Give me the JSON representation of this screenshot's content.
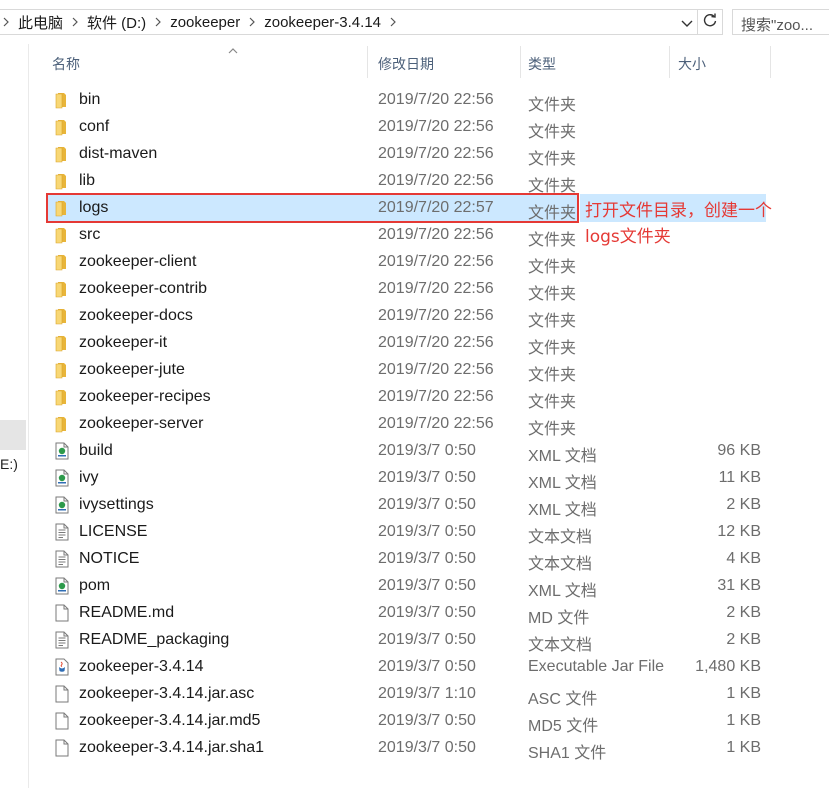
{
  "address_bar": {
    "segments": [
      "此电脑",
      "软件 (D:)",
      "zookeeper",
      "zookeeper-3.4.14"
    ],
    "search_placeholder": "搜索\"zoo..."
  },
  "nav_pane": {
    "partial_label": "E:)"
  },
  "columns": {
    "name": "名称",
    "date": "修改日期",
    "type": "类型",
    "size": "大小"
  },
  "files": [
    {
      "name": "bin",
      "date": "2019/7/20 22:56",
      "type": "文件夹",
      "size": "",
      "icon": "folder-icon"
    },
    {
      "name": "conf",
      "date": "2019/7/20 22:56",
      "type": "文件夹",
      "size": "",
      "icon": "folder-icon"
    },
    {
      "name": "dist-maven",
      "date": "2019/7/20 22:56",
      "type": "文件夹",
      "size": "",
      "icon": "folder-icon"
    },
    {
      "name": "lib",
      "date": "2019/7/20 22:56",
      "type": "文件夹",
      "size": "",
      "icon": "folder-icon"
    },
    {
      "name": "logs",
      "date": "2019/7/20 22:57",
      "type": "文件夹",
      "size": "",
      "icon": "folder-icon",
      "selected": true
    },
    {
      "name": "src",
      "date": "2019/7/20 22:56",
      "type": "文件夹",
      "size": "",
      "icon": "folder-icon"
    },
    {
      "name": "zookeeper-client",
      "date": "2019/7/20 22:56",
      "type": "文件夹",
      "size": "",
      "icon": "folder-icon"
    },
    {
      "name": "zookeeper-contrib",
      "date": "2019/7/20 22:56",
      "type": "文件夹",
      "size": "",
      "icon": "folder-icon"
    },
    {
      "name": "zookeeper-docs",
      "date": "2019/7/20 22:56",
      "type": "文件夹",
      "size": "",
      "icon": "folder-icon"
    },
    {
      "name": "zookeeper-it",
      "date": "2019/7/20 22:56",
      "type": "文件夹",
      "size": "",
      "icon": "folder-icon"
    },
    {
      "name": "zookeeper-jute",
      "date": "2019/7/20 22:56",
      "type": "文件夹",
      "size": "",
      "icon": "folder-icon"
    },
    {
      "name": "zookeeper-recipes",
      "date": "2019/7/20 22:56",
      "type": "文件夹",
      "size": "",
      "icon": "folder-icon"
    },
    {
      "name": "zookeeper-server",
      "date": "2019/7/20 22:56",
      "type": "文件夹",
      "size": "",
      "icon": "folder-icon"
    },
    {
      "name": "build",
      "date": "2019/3/7 0:50",
      "type": "XML 文档",
      "size": "96 KB",
      "icon": "xml-file-icon"
    },
    {
      "name": "ivy",
      "date": "2019/3/7 0:50",
      "type": "XML 文档",
      "size": "11 KB",
      "icon": "xml-file-icon"
    },
    {
      "name": "ivysettings",
      "date": "2019/3/7 0:50",
      "type": "XML 文档",
      "size": "2 KB",
      "icon": "xml-file-icon"
    },
    {
      "name": "LICENSE",
      "date": "2019/3/7 0:50",
      "type": "文本文档",
      "size": "12 KB",
      "icon": "text-file-icon"
    },
    {
      "name": "NOTICE",
      "date": "2019/3/7 0:50",
      "type": "文本文档",
      "size": "4 KB",
      "icon": "text-file-icon"
    },
    {
      "name": "pom",
      "date": "2019/3/7 0:50",
      "type": "XML 文档",
      "size": "31 KB",
      "icon": "xml-file-icon"
    },
    {
      "name": "README.md",
      "date": "2019/3/7 0:50",
      "type": "MD 文件",
      "size": "2 KB",
      "icon": "blank-file-icon"
    },
    {
      "name": "README_packaging",
      "date": "2019/3/7 0:50",
      "type": "文本文档",
      "size": "2 KB",
      "icon": "text-file-icon"
    },
    {
      "name": "zookeeper-3.4.14",
      "date": "2019/3/7 0:50",
      "type": "Executable Jar File",
      "size": "1,480 KB",
      "icon": "jar-file-icon"
    },
    {
      "name": "zookeeper-3.4.14.jar.asc",
      "date": "2019/3/7 1:10",
      "type": "ASC 文件",
      "size": "1 KB",
      "icon": "blank-file-icon"
    },
    {
      "name": "zookeeper-3.4.14.jar.md5",
      "date": "2019/3/7 0:50",
      "type": "MD5 文件",
      "size": "1 KB",
      "icon": "blank-file-icon"
    },
    {
      "name": "zookeeper-3.4.14.jar.sha1",
      "date": "2019/3/7 0:50",
      "type": "SHA1 文件",
      "size": "1 KB",
      "icon": "blank-file-icon"
    }
  ],
  "annotation": {
    "line1": "打开文件目录，创建一个",
    "line2": "logs文件夹"
  },
  "colors": {
    "selection": "#cce8ff",
    "highlight_border": "#e53935",
    "annotation_text": "#e53935",
    "folder": "#f3c44f"
  }
}
